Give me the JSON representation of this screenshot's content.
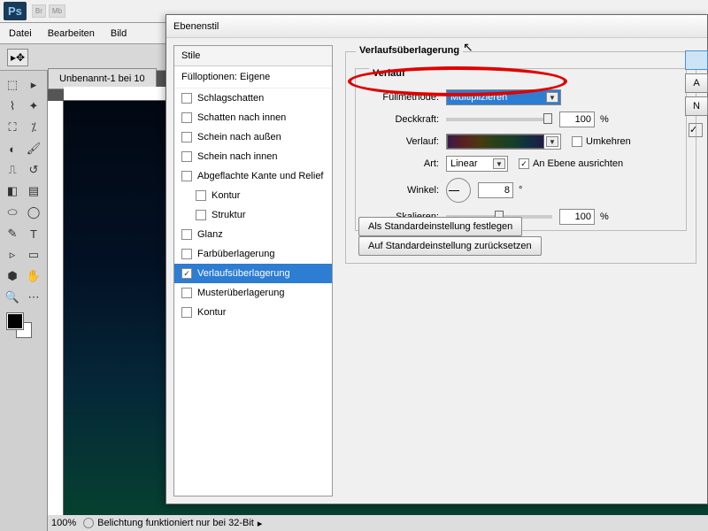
{
  "app": {
    "ps": "Ps",
    "br": "Br",
    "mb": "Mb"
  },
  "menu": {
    "file": "Datei",
    "edit": "Bearbeiten",
    "image": "Bild"
  },
  "doc": {
    "tab": "Unbenannt-1 bei 10"
  },
  "status": {
    "zoom": "100%",
    "msg": "Belichtung funktioniert nur bei 32-Bit"
  },
  "dialog": {
    "title": "Ebenenstil",
    "styles_hdr": "Stile",
    "fill_opts": "Fülloptionen: Eigene",
    "items": [
      "Schlagschatten",
      "Schatten nach innen",
      "Schein nach außen",
      "Schein nach innen",
      "Abgeflachte Kante und Relief",
      "Kontur",
      "Struktur",
      "Glanz",
      "Farbüberlagerung",
      "Verlaufsüberlagerung",
      "Musterüberlagerung",
      "Kontur"
    ],
    "group": "Verlaufsüberlagerung",
    "subgroup": "Verlauf",
    "labels": {
      "blend": "Füllmethode:",
      "opacity": "Deckkraft:",
      "gradient": "Verlauf:",
      "style": "Art:",
      "angle": "Winkel:",
      "scale": "Skalieren:",
      "reverse": "Umkehren",
      "align": "An Ebene ausrichten"
    },
    "values": {
      "blend": "Multiplizieren",
      "opacity": "100",
      "opacity_unit": "%",
      "style": "Linear",
      "angle": "8",
      "angle_unit": "°",
      "scale": "100",
      "scale_unit": "%"
    },
    "buttons": {
      "setdefault": "Als Standardeinstellung festlegen",
      "reset": "Auf Standardeinstellung zurücksetzen"
    },
    "side": {
      "a": "A",
      "n": "N"
    }
  }
}
